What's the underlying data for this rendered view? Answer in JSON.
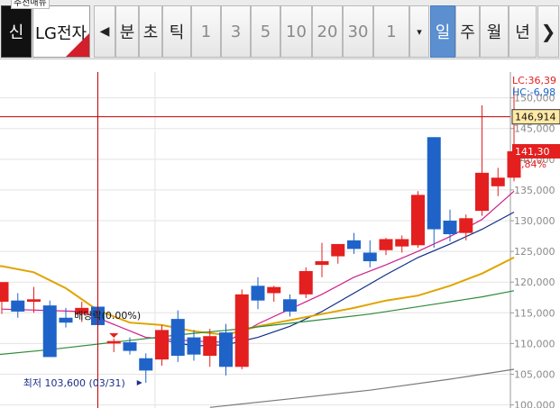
{
  "toolbar": {
    "tab_label": "추천매뉴",
    "mode_label": "신",
    "stock_name": "LG전자",
    "nav_left": "◀",
    "nav_right": "❯",
    "period_words": [
      "분",
      "초",
      "틱"
    ],
    "interval_numbers": [
      "1",
      "3",
      "5",
      "10",
      "20",
      "30"
    ],
    "count_value": "1",
    "dropdown_arrow": "▾",
    "period_units": [
      {
        "label": "일",
        "active": true
      },
      {
        "label": "주",
        "active": false
      },
      {
        "label": "월",
        "active": false
      },
      {
        "label": "년",
        "active": false
      }
    ]
  },
  "chart_data": {
    "type": "candlestick",
    "y_ticks": [
      "150,000",
      "145,000",
      "140,000",
      "135,000",
      "130,000",
      "125,000",
      "120,000",
      "115,000",
      "110,000",
      "105,000",
      "100,000"
    ],
    "y_tick_values": [
      150000,
      145000,
      140000,
      135000,
      130000,
      125000,
      120000,
      115000,
      110000,
      105000,
      100000
    ],
    "ylim": [
      99500,
      154200
    ],
    "colors": {
      "up": "#e41f1f",
      "down": "#1f63c8",
      "ma5": "#d0208a",
      "ma20": "#0d2f86",
      "ma60": "#e0a400",
      "ma120": "#2e8b3a",
      "ma240": "#7a7a7a",
      "crosshair": "#c00000"
    },
    "candles": [
      {
        "open": 116800,
        "high": 119500,
        "low": 114800,
        "close": 120000
      },
      {
        "open": 117000,
        "high": 118200,
        "low": 114200,
        "close": 115200
      },
      {
        "open": 116800,
        "high": 119200,
        "low": 115000,
        "close": 117200
      },
      {
        "open": 116200,
        "high": 117000,
        "low": 109000,
        "close": 107800
      },
      {
        "open": 114200,
        "high": 115800,
        "low": 112600,
        "close": 113400
      },
      {
        "open": 114800,
        "high": 116800,
        "low": 113500,
        "close": 115800
      },
      {
        "open": 116000,
        "high": 116800,
        "low": 111000,
        "close": 113000
      },
      {
        "open": 110000,
        "high": 110800,
        "low": 108600,
        "close": 110400
      },
      {
        "open": 110200,
        "high": 111000,
        "low": 108200,
        "close": 108800
      },
      {
        "open": 107600,
        "high": 108400,
        "low": 103600,
        "close": 105600
      },
      {
        "open": 107400,
        "high": 113000,
        "low": 106400,
        "close": 112200
      },
      {
        "open": 114000,
        "high": 115400,
        "low": 107000,
        "close": 108000
      },
      {
        "open": 111000,
        "high": 112200,
        "low": 107200,
        "close": 108200
      },
      {
        "open": 108000,
        "high": 112400,
        "low": 106200,
        "close": 111200
      },
      {
        "open": 111800,
        "high": 113200,
        "low": 104800,
        "close": 106200
      },
      {
        "open": 106200,
        "high": 118800,
        "low": 105800,
        "close": 118000
      },
      {
        "open": 119400,
        "high": 120800,
        "low": 115600,
        "close": 117000
      },
      {
        "open": 118200,
        "high": 119400,
        "low": 116800,
        "close": 119200
      },
      {
        "open": 117200,
        "high": 118000,
        "low": 114400,
        "close": 115200
      },
      {
        "open": 118000,
        "high": 122400,
        "low": 117400,
        "close": 121800
      },
      {
        "open": 122800,
        "high": 126400,
        "low": 120800,
        "close": 123400
      },
      {
        "open": 124200,
        "high": 126200,
        "low": 123000,
        "close": 126200
      },
      {
        "open": 126800,
        "high": 128000,
        "low": 124600,
        "close": 125400
      },
      {
        "open": 124800,
        "high": 126800,
        "low": 122400,
        "close": 123400
      },
      {
        "open": 125200,
        "high": 127200,
        "low": 124400,
        "close": 127000
      },
      {
        "open": 125800,
        "high": 127600,
        "low": 124800,
        "close": 127000
      },
      {
        "open": 126000,
        "high": 134800,
        "low": 125600,
        "close": 134200
      },
      {
        "open": 143600,
        "high": 143600,
        "low": 125600,
        "close": 128600
      },
      {
        "open": 130000,
        "high": 131800,
        "low": 126600,
        "close": 127800
      },
      {
        "open": 128000,
        "high": 131000,
        "low": 126800,
        "close": 130400
      },
      {
        "open": 131600,
        "high": 148800,
        "low": 130800,
        "close": 137800
      },
      {
        "open": 135600,
        "high": 138600,
        "low": 134000,
        "close": 137000
      },
      {
        "open": 137000,
        "high": 151800,
        "low": 136400,
        "close": 141300
      }
    ],
    "moving_averages": [
      {
        "id": "ma5",
        "points": [
          [
            -1,
            null
          ],
          [
            0,
            115600
          ],
          [
            5,
            115200
          ],
          [
            9,
            111000
          ],
          [
            12,
            110400
          ],
          [
            14,
            110200
          ],
          [
            16,
            113200
          ],
          [
            18,
            115600
          ],
          [
            20,
            118000
          ],
          [
            22,
            120800
          ],
          [
            24,
            122800
          ],
          [
            26,
            125000
          ],
          [
            28,
            127400
          ],
          [
            30,
            130200
          ],
          [
            32,
            134800
          ]
        ]
      },
      {
        "id": "ma20",
        "points": [
          [
            10,
            110600
          ],
          [
            12,
            109600
          ],
          [
            14,
            109800
          ],
          [
            16,
            111000
          ],
          [
            18,
            112800
          ],
          [
            20,
            115200
          ],
          [
            22,
            118200
          ],
          [
            24,
            121200
          ],
          [
            26,
            124000
          ],
          [
            28,
            126200
          ],
          [
            30,
            128600
          ],
          [
            32,
            131400
          ]
        ]
      },
      {
        "id": "ma60",
        "points": [
          [
            -1,
            122600
          ],
          [
            0,
            122600
          ],
          [
            2,
            121600
          ],
          [
            4,
            119000
          ],
          [
            6,
            115400
          ],
          [
            8,
            113400
          ],
          [
            10,
            113000
          ],
          [
            12,
            112000
          ],
          [
            14,
            111400
          ],
          [
            16,
            112800
          ],
          [
            18,
            113800
          ],
          [
            20,
            114800
          ],
          [
            22,
            115800
          ],
          [
            24,
            117000
          ],
          [
            26,
            117800
          ],
          [
            28,
            119400
          ],
          [
            30,
            121400
          ],
          [
            32,
            124000
          ]
        ]
      },
      {
        "id": "ma120",
        "points": [
          [
            -1,
            108000
          ],
          [
            3,
            109000
          ],
          [
            7,
            110200
          ],
          [
            11,
            111400
          ],
          [
            15,
            112400
          ],
          [
            19,
            113600
          ],
          [
            23,
            114800
          ],
          [
            27,
            116400
          ],
          [
            30,
            117600
          ],
          [
            32,
            118600
          ]
        ]
      },
      {
        "id": "ma240",
        "points": [
          [
            13,
            99600
          ],
          [
            18,
            101000
          ],
          [
            23,
            102400
          ],
          [
            28,
            104200
          ],
          [
            32,
            105800
          ]
        ]
      }
    ],
    "annotations": {
      "lc_label": "LC:36,39",
      "hc_label": "HC:-6,98",
      "crosshair_price": "146,914",
      "crosshair_value": 146914,
      "crosshair_candle": 6,
      "current_price": "141,30",
      "current_value": 141300,
      "change_pct": "2,84%",
      "ex_dividend_label": "배당락(0.00%)",
      "ex_dividend_candle": 7,
      "low_label": "최저 103,600 (03/31)",
      "low_value": 103600,
      "low_candle": 9
    }
  }
}
